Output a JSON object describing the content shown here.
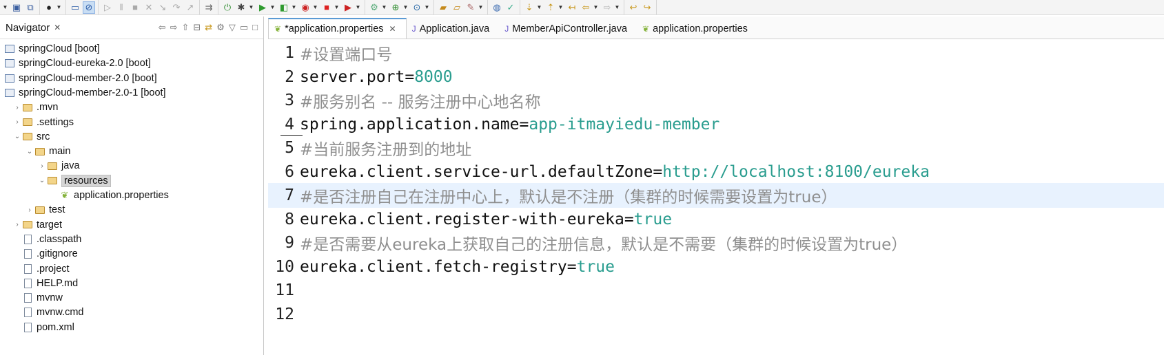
{
  "toolbar": {
    "icons": [
      "dropdown-icon",
      "save-icon",
      "save-all-icon",
      "profile-icon",
      "terminal-icon",
      "skip-breakpoints-icon",
      "resume-icon",
      "suspend-icon",
      "terminate-icon",
      "disconnect-icon",
      "step-into-icon",
      "step-over-icon",
      "step-return-icon",
      "drop-to-frame-icon",
      "use-step-filters-icon",
      "debug-icon",
      "run-icon",
      "coverage-icon",
      "run-external-icon",
      "new-server-icon",
      "new-class-icon",
      "open-type-icon",
      "open-task-icon",
      "search-icon",
      "web-browser-icon",
      "next-annotation-icon",
      "prev-annotation-icon",
      "last-edit-icon",
      "back-icon",
      "forward-icon",
      "pin-icon"
    ]
  },
  "navigator": {
    "title": "Navigator",
    "close": "✕",
    "items": [
      {
        "label": "springCloud [boot]",
        "type": "project"
      },
      {
        "label": "springCloud-eureka-2.0 [boot]",
        "type": "project"
      },
      {
        "label": "springCloud-member-2.0 [boot]",
        "type": "project"
      },
      {
        "label": "springCloud-member-2.0-1 [boot]",
        "type": "project"
      },
      {
        "label": ".mvn",
        "type": "folder"
      },
      {
        "label": ".settings",
        "type": "folder"
      },
      {
        "label": "src",
        "type": "folder"
      },
      {
        "label": "main",
        "type": "folder"
      },
      {
        "label": "java",
        "type": "folder"
      },
      {
        "label": "resources",
        "type": "folder"
      },
      {
        "label": "application.properties",
        "type": "properties"
      },
      {
        "label": "test",
        "type": "folder"
      },
      {
        "label": "target",
        "type": "folder"
      },
      {
        "label": ".classpath",
        "type": "xml"
      },
      {
        "label": ".gitignore",
        "type": "file"
      },
      {
        "label": ".project",
        "type": "xml"
      },
      {
        "label": "HELP.md",
        "type": "md"
      },
      {
        "label": "mvnw",
        "type": "file"
      },
      {
        "label": "mvnw.cmd",
        "type": "file"
      },
      {
        "label": "pom.xml",
        "type": "xml"
      }
    ]
  },
  "editor": {
    "tabs": [
      {
        "label": "*application.properties",
        "active": true,
        "close": "✕"
      },
      {
        "label": "Application.java",
        "active": false
      },
      {
        "label": "MemberApiController.java",
        "active": false
      },
      {
        "label": "application.properties",
        "active": false
      }
    ],
    "lines": [
      {
        "num": "1",
        "comment": "#设置端口号"
      },
      {
        "num": "2",
        "key": "server.port",
        "eq": "=",
        "value": "8000"
      },
      {
        "num": "3",
        "comment": "#服务别名 -- 服务注册中心地名称"
      },
      {
        "num": "4",
        "key": "spring.application.name",
        "eq": "=",
        "value": "app-itmayiedu-member"
      },
      {
        "num": "5",
        "comment": "#当前服务注册到的地址"
      },
      {
        "num": "6",
        "key": "eureka.client.service-url.defaultZone",
        "eq": "=",
        "value": "http://localhost:8100/eureka"
      },
      {
        "num": "7",
        "comment": "#是否注册自己在注册中心上，默认是不注册（集群的时候需要设置为true）"
      },
      {
        "num": "8",
        "key": "eureka.client.register-with-eureka",
        "eq": "=",
        "value": "true"
      },
      {
        "num": "9",
        "comment": "#是否需要从eureka上获取自己的注册信息，默认是不需要（集群的时候设置为true）"
      },
      {
        "num": "10",
        "key": "eureka.client.fetch-registry",
        "eq": "=",
        "value": "true"
      },
      {
        "num": "11"
      },
      {
        "num": "12"
      }
    ]
  }
}
